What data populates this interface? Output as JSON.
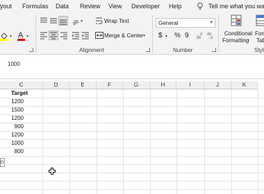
{
  "menu": {
    "tabs": [
      "yout",
      "Formulas",
      "Data",
      "Review",
      "View",
      "Developer",
      "Help"
    ],
    "tell_me": "Tell me what you want"
  },
  "ribbon": {
    "wrap_text": "Wrap Text",
    "merge_center": "Merge & Center",
    "alignment_label": "Alignment",
    "number_format": "General",
    "number_label": "Number",
    "currency_symbol": "$",
    "percent_symbol": "%",
    "comma_symbol": "9",
    "conditional_formatting_1": "Conditional",
    "conditional_formatting_2": "Formatting",
    "format_table_1": "Form",
    "format_table_2": "Tab",
    "styles_label": "Style"
  },
  "formula_bar": {
    "value": "1000"
  },
  "sheet": {
    "columns": [
      "C",
      "D",
      "E",
      "F",
      "G",
      "H",
      "I",
      "J",
      "K"
    ],
    "header_cell": "Target",
    "values": [
      "1200",
      "1500",
      "1200",
      "900",
      "1200",
      "1000",
      "800"
    ]
  },
  "colors": {
    "ribbon_bg": "#f3f3f3",
    "fill_yellow": "#ffff00",
    "font_red": "#e00000",
    "grid_line": "#e2e2e2"
  }
}
